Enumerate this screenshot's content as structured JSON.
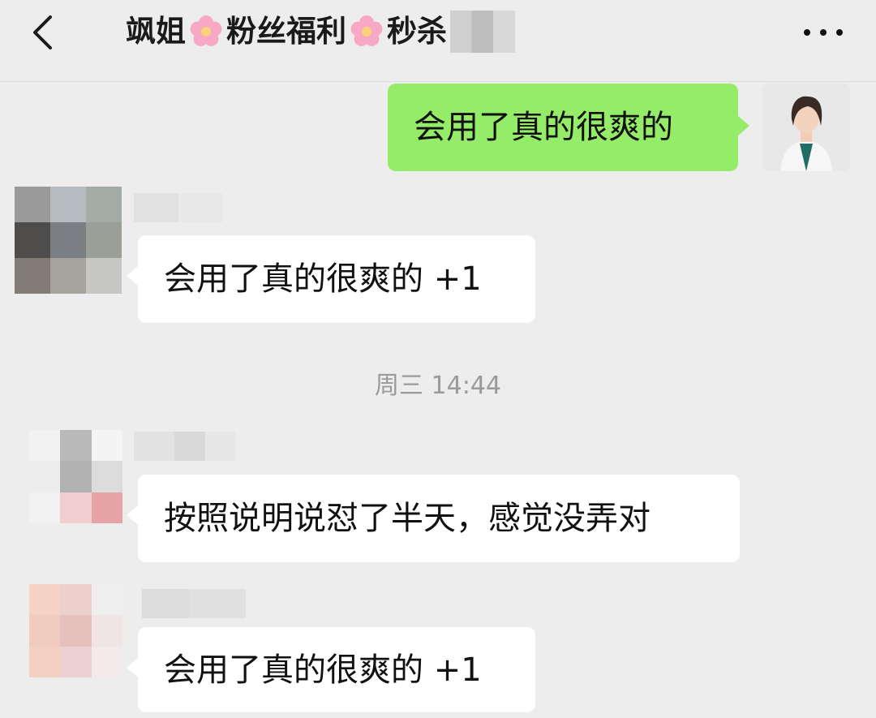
{
  "header": {
    "title_part1": "飒姐",
    "title_part2": "粉丝福利",
    "title_part3": "秒杀",
    "flower_icon": "cherry-blossom"
  },
  "messages": [
    {
      "sender": "self",
      "text": "会用了真的很爽的"
    },
    {
      "sender": "other",
      "text": "会用了真的很爽的 +1"
    },
    {
      "sender": "other",
      "text": "按照说明说怼了半天，感觉没弄对"
    },
    {
      "sender": "other",
      "text": "会用了真的很爽的 +1"
    }
  ],
  "timestamp": "周三 14:44",
  "colors": {
    "background": "#ededed",
    "self_bubble": "#95ec69",
    "other_bubble": "#ffffff"
  }
}
